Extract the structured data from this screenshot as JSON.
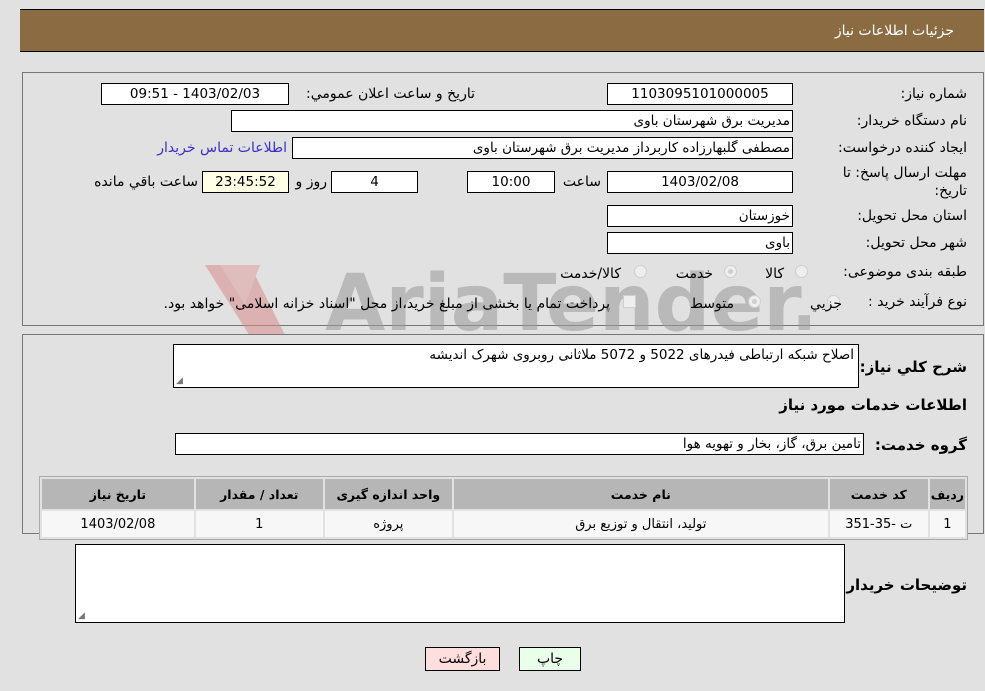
{
  "header": {
    "title": "جزئیات اطلاعات نیاز"
  },
  "form": {
    "need_number_label": "شماره نیاز:",
    "need_number": "1103095101000005",
    "announce_label": "تاریخ و ساعت اعلان عمومي:",
    "announce_value": "1403/02/03 - 09:51",
    "buyer_org_label": "نام دستگاه خریدار:",
    "buyer_org": "مدیریت برق شهرستان باوی",
    "creator_label": "ایجاد کننده درخواست:",
    "creator": "مصطفی گلبهارزاده کاربرداز مدیریت برق شهرستان باوی",
    "contact_link": "اطلاعات تماس خریدار",
    "deadline_label": "مهلت ارسال پاسخ: تا تاریخ:",
    "deadline_date": "1403/02/08",
    "time_label": "ساعت",
    "deadline_time": "10:00",
    "days_value": "4",
    "days_label": "روز و",
    "remaining_time": "23:45:52",
    "remaining_label": "ساعت باقي مانده",
    "province_label": "استان محل تحویل:",
    "province": "خوزستان",
    "city_label": "شهر محل تحویل:",
    "city": "باوی",
    "category_label": "طبقه بندی موضوعی:",
    "category_options": [
      {
        "label": "کالا",
        "checked": false
      },
      {
        "label": "خدمت",
        "checked": true
      },
      {
        "label": "کالا/خدمت",
        "checked": false
      }
    ],
    "process_label": "نوع فرآیند خرید :",
    "process_options": [
      {
        "label": "جزيي",
        "checked": false
      },
      {
        "label": "متوسط",
        "checked": true
      }
    ],
    "treasury_note": "پرداخت تمام یا بخشی از مبلغ خرید،از محل \"اسناد خزانه اسلامی\" خواهد بود."
  },
  "description": {
    "label": "شرح کلي نیاز:",
    "value": "اصلاح شبکه ارتباطی فیدرهای 5022 و 5072 ملاثانی روبروی شهرک اندیشه"
  },
  "services": {
    "section_title": "اطلاعات خدمات مورد نیاز",
    "group_label": "گروه خدمت:",
    "group_value": "تامین برق، گاز، بخار و تهویه هوا",
    "columns": [
      "ردیف",
      "کد خدمت",
      "نام خدمت",
      "واحد اندازه گیری",
      "تعداد / مقدار",
      "تاریخ نیاز"
    ],
    "rows": [
      [
        "1",
        "ت -35-351",
        "تولید، انتقال و توزیع برق",
        "پروژه",
        "1",
        "1403/02/08"
      ]
    ]
  },
  "buyer_notes": {
    "label": "توضیحات خریدار:",
    "value": ""
  },
  "buttons": {
    "print": "چاپ",
    "back": "بازگشت"
  },
  "watermark": {
    "text": "AriaTender.neT"
  }
}
